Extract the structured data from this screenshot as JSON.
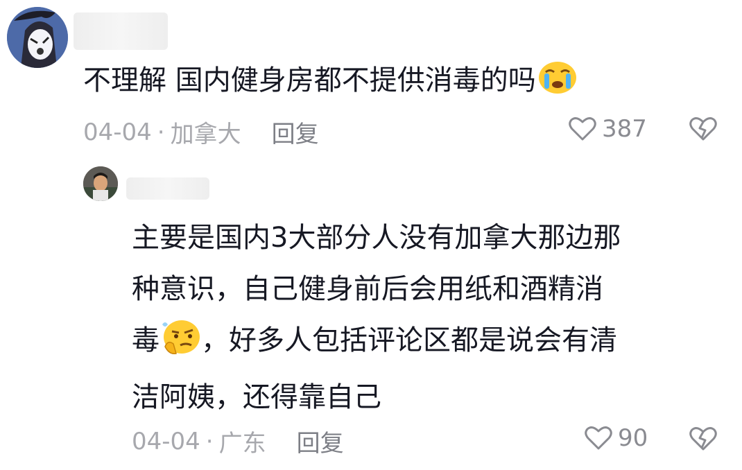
{
  "comments": {
    "main": {
      "text": "不理解 国内健身房都不提供消毒的吗",
      "emoji": "crying-face-emoji",
      "date": "04-04",
      "location": "加拿大",
      "reply_label": "回复",
      "likes": "387"
    },
    "reply": {
      "text_line1": "主要是国内3大部分人没有加拿大那边那",
      "text_line2": "种意识，自己健身前后会用纸和酒精消",
      "text_line3_start": "毒",
      "text_line3_end": "，好多人包括评论区都是说会有清",
      "text_line4": "洁阿姨，还得靠自己",
      "emoji": "thinking-face-emoji",
      "date": "04-04",
      "location": "广东",
      "reply_label": "回复",
      "likes": "90"
    }
  },
  "separator": "·",
  "colors": {
    "text": "#161823",
    "meta": "#a7a8ad",
    "icon": "#8a8b91"
  }
}
